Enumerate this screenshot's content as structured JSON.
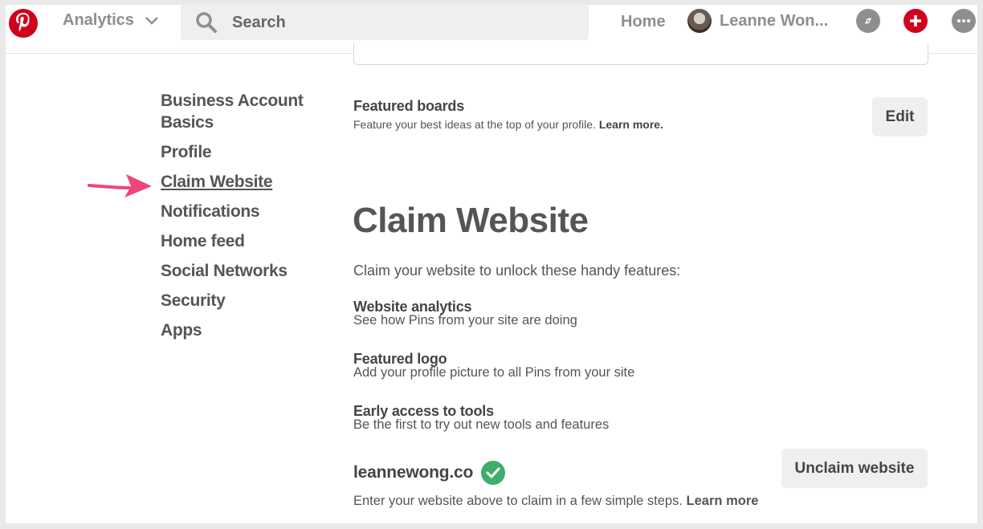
{
  "topbar": {
    "analytics_label": "Analytics",
    "search_placeholder": "Search",
    "home_label": "Home",
    "user_name": "Leanne Won..."
  },
  "sidebar": {
    "items": [
      {
        "label": "Business Account Basics"
      },
      {
        "label": "Profile"
      },
      {
        "label": "Claim Website"
      },
      {
        "label": "Notifications"
      },
      {
        "label": "Home feed"
      },
      {
        "label": "Social Networks"
      },
      {
        "label": "Security"
      },
      {
        "label": "Apps"
      }
    ],
    "active_index": 2
  },
  "featured_boards": {
    "title": "Featured boards",
    "description": "Feature your best ideas at the top of your profile.",
    "learn_more": "Learn more.",
    "edit_label": "Edit"
  },
  "claim": {
    "heading": "Claim Website",
    "intro": "Claim your website to unlock these handy features:",
    "features": [
      {
        "title": "Website analytics",
        "desc": "See how Pins from your site are doing"
      },
      {
        "title": "Featured logo",
        "desc": "Add your profile picture to all Pins from your site"
      },
      {
        "title": "Early access to tools",
        "desc": "Be the first to try out new tools and features"
      }
    ],
    "domain": "leannewong.co",
    "unclaim_label": "Unclaim website",
    "note": "Enter your website above to claim in a few simple steps.",
    "note_link": "Learn more"
  },
  "colors": {
    "brand": "#d0021b",
    "arrow": "#f0457a",
    "verified": "#3fad6b"
  }
}
